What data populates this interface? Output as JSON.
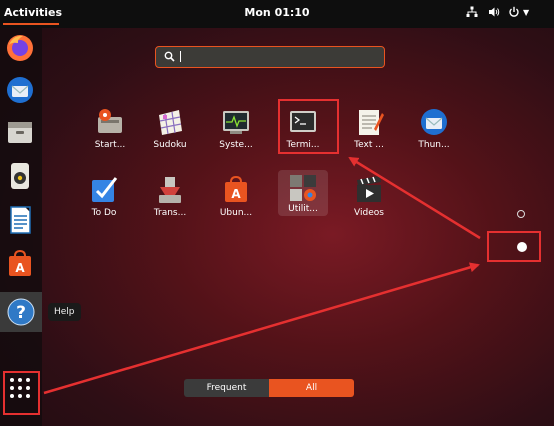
{
  "topbar": {
    "activities": "Activities",
    "clock": "Mon 01:10",
    "network_icon": "network-icon",
    "volume_icon": "volume-icon",
    "power_icon": "power-icon"
  },
  "dock": {
    "items": [
      {
        "name": "firefox",
        "icon": "firefox-icon"
      },
      {
        "name": "thunderbird",
        "icon": "thunderbird-icon"
      },
      {
        "name": "files",
        "icon": "files-icon"
      },
      {
        "name": "rhythmbox",
        "icon": "rhythmbox-icon"
      },
      {
        "name": "libreoffice-writer",
        "icon": "writer-icon"
      },
      {
        "name": "ubuntu-software",
        "icon": "software-icon"
      },
      {
        "name": "help",
        "icon": "help-icon"
      },
      {
        "name": "show-applications",
        "icon": "app-grid-icon"
      }
    ],
    "tooltip": "Help"
  },
  "search": {
    "value": "",
    "placeholder": ""
  },
  "apps": [
    {
      "label": "Start...",
      "icon": "startup-disk-icon"
    },
    {
      "label": "Sudoku",
      "icon": "sudoku-icon"
    },
    {
      "label": "Syste...",
      "icon": "system-monitor-icon"
    },
    {
      "label": "Termi...",
      "icon": "terminal-icon"
    },
    {
      "label": "Text ...",
      "icon": "text-editor-icon"
    },
    {
      "label": "Thun...",
      "icon": "thunderbird-icon"
    },
    {
      "label": "To Do",
      "icon": "todo-icon"
    },
    {
      "label": "Trans...",
      "icon": "transmission-icon"
    },
    {
      "label": "Ubun...",
      "icon": "ubuntu-software-icon"
    },
    {
      "label": "Utilit...",
      "icon": "utilities-folder-icon"
    },
    {
      "label": "Videos",
      "icon": "videos-icon"
    }
  ],
  "tabs": {
    "frequent": "Frequent",
    "all": "All",
    "active": "All"
  },
  "pages": {
    "count": 2,
    "current": 2
  },
  "colors": {
    "accent": "#e95420",
    "annotation": "#e53030"
  }
}
